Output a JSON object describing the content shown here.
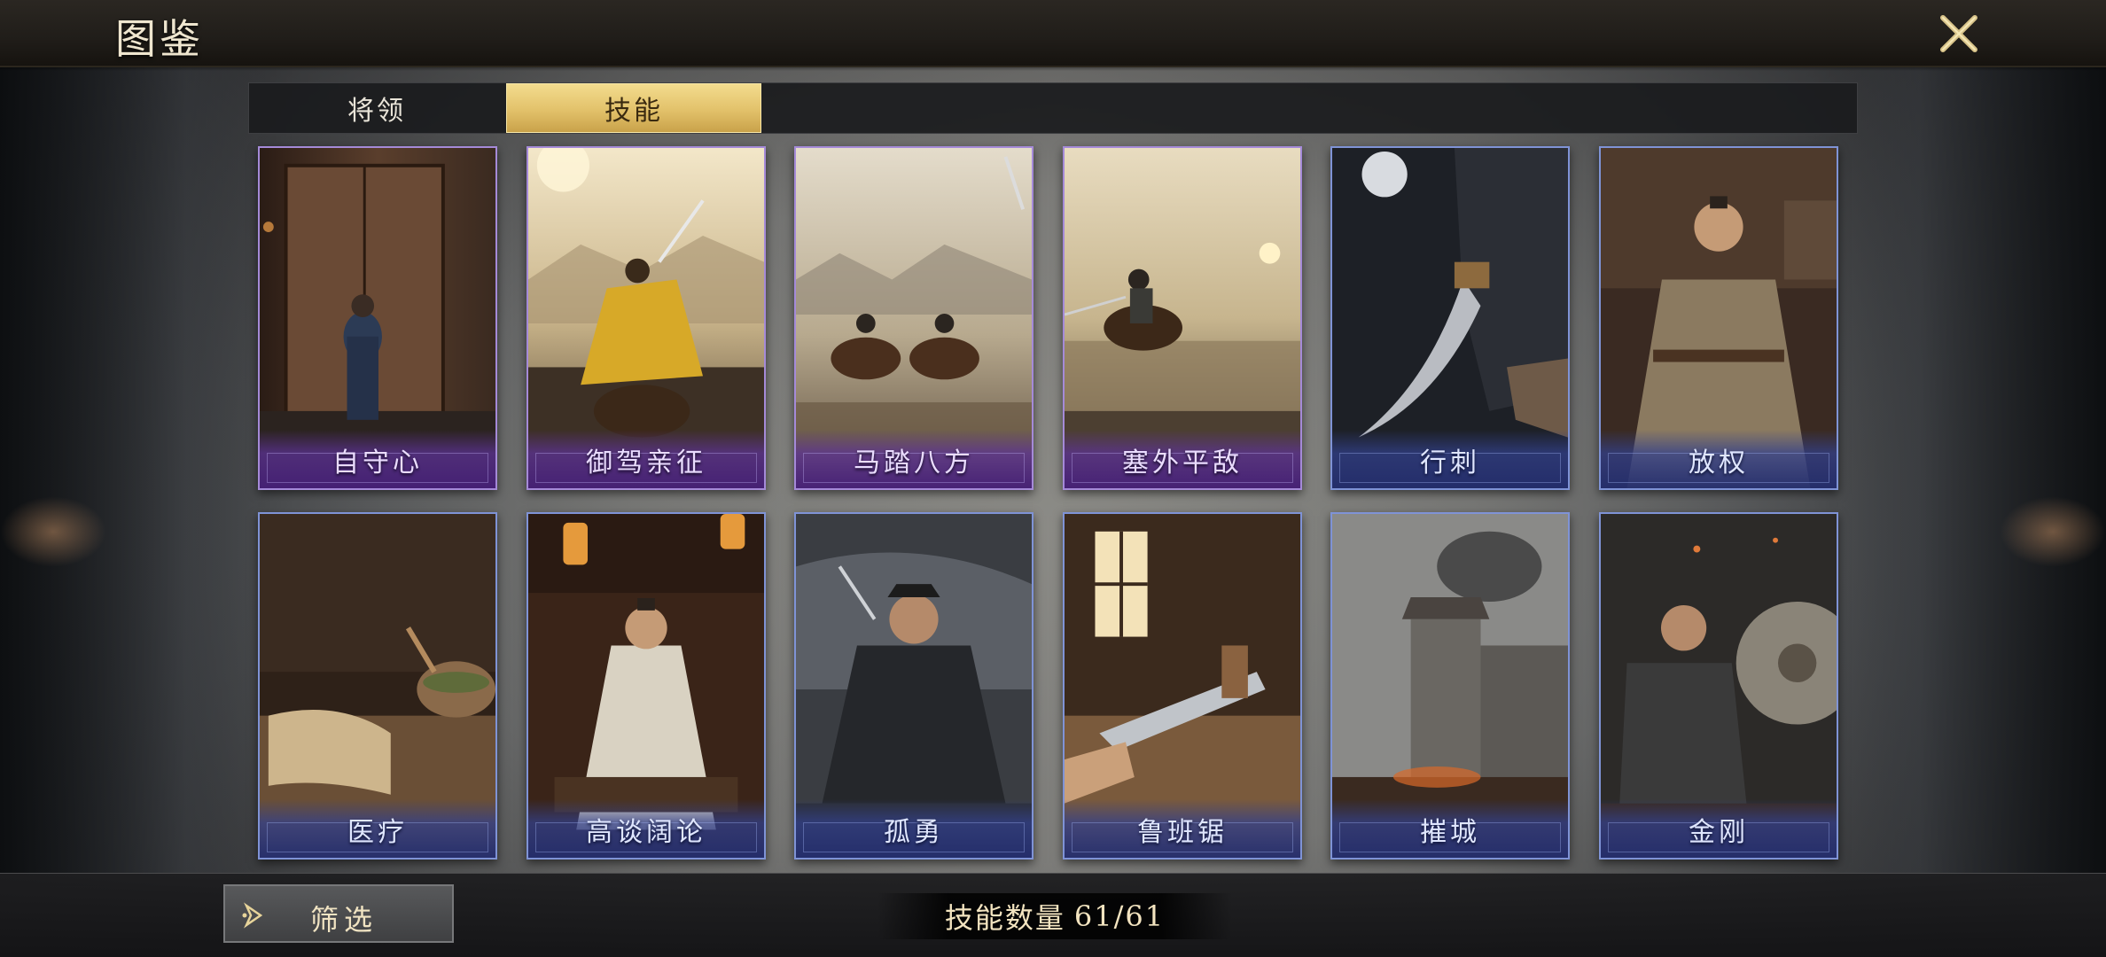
{
  "header": {
    "title": "图鉴"
  },
  "tabs": [
    {
      "label": "将领",
      "selected": false
    },
    {
      "label": "技能",
      "selected": true
    }
  ],
  "cards": [
    {
      "name": "自守心",
      "frame": "purple"
    },
    {
      "name": "御驾亲征",
      "frame": "purple"
    },
    {
      "name": "马踏八方",
      "frame": "purple"
    },
    {
      "name": "塞外平敌",
      "frame": "purple"
    },
    {
      "name": "行刺",
      "frame": "blue"
    },
    {
      "name": "放权",
      "frame": "blue"
    },
    {
      "name": "医疗",
      "frame": "blue"
    },
    {
      "name": "高谈阔论",
      "frame": "blue"
    },
    {
      "name": "孤勇",
      "frame": "blue"
    },
    {
      "name": "鲁班锯",
      "frame": "blue"
    },
    {
      "name": "摧城",
      "frame": "blue"
    },
    {
      "name": "金刚",
      "frame": "blue"
    }
  ],
  "footer": {
    "filter_label": "筛选",
    "count_label": "技能数量",
    "count_value": "61/61"
  },
  "colors": {
    "tab_active": "#e2c16a",
    "frame_purple": "#a58ad8",
    "frame_blue": "#7f93d6",
    "title_text": "#efe6cf"
  }
}
